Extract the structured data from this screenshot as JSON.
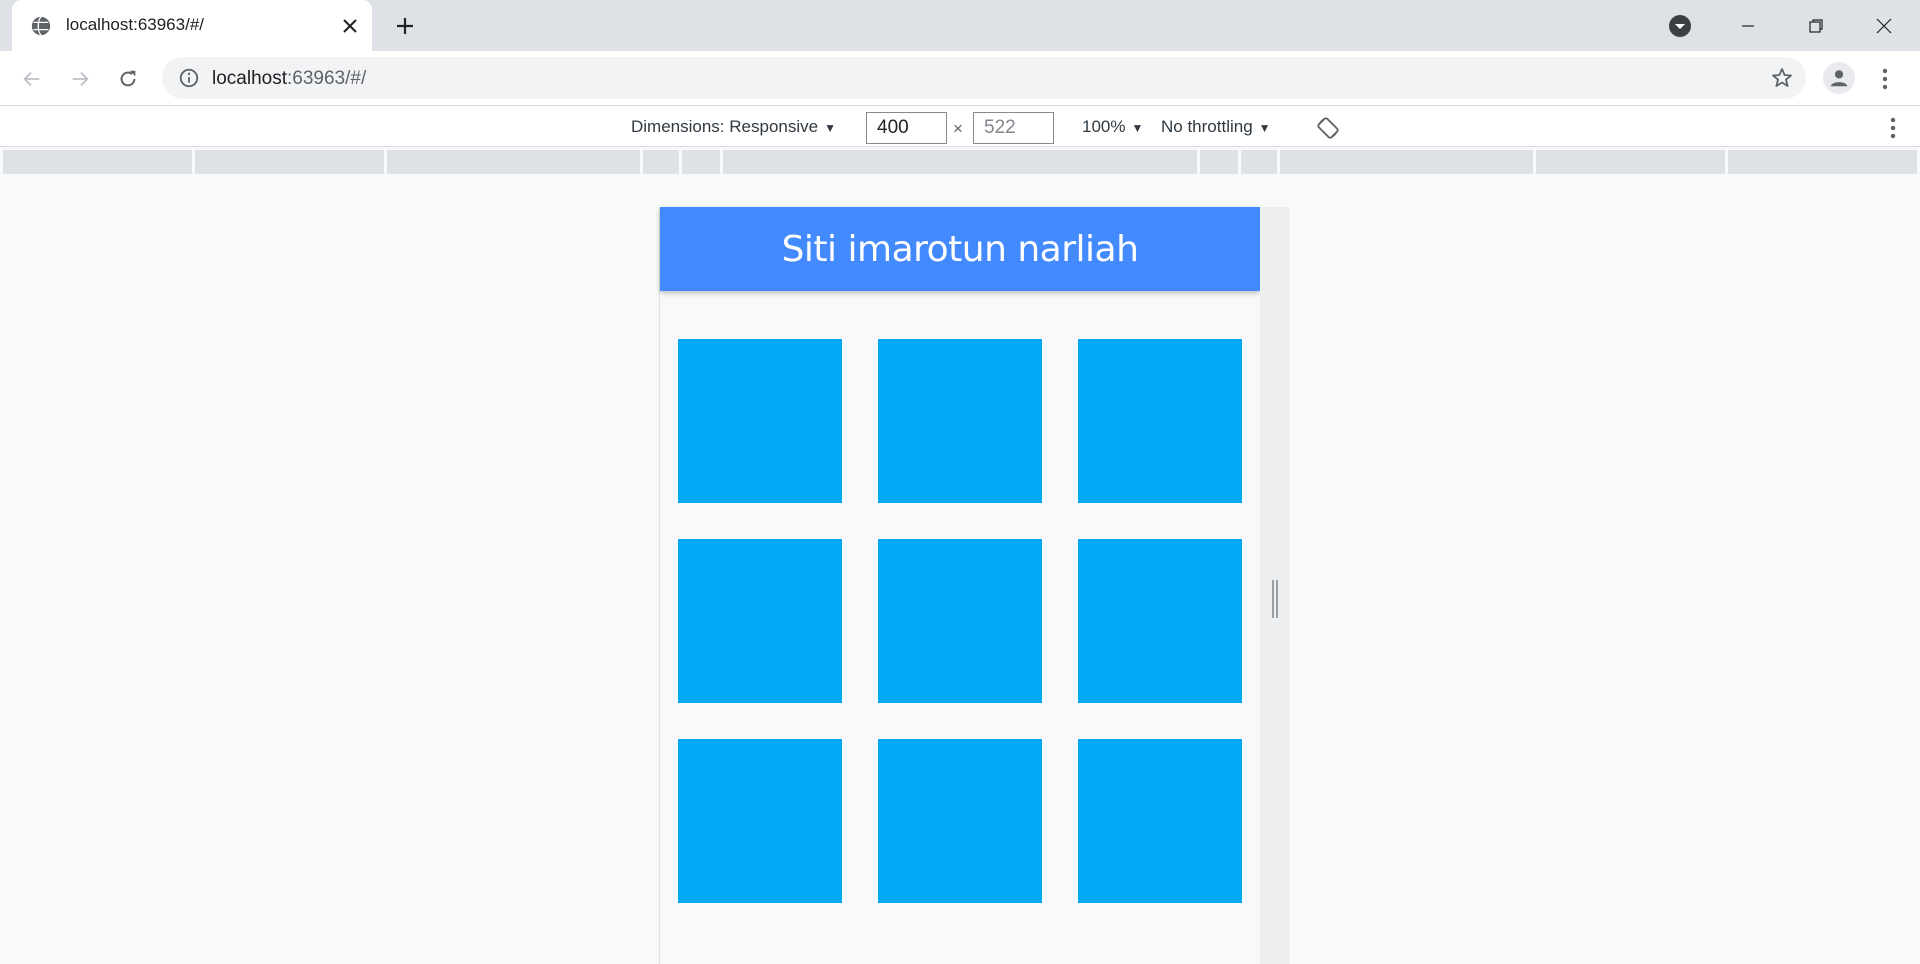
{
  "browser": {
    "tab_title": "localhost:63963/#/",
    "url_host": "localhost",
    "url_path": ":63963/#/"
  },
  "devtools": {
    "dimensions_label": "Dimensions: Responsive",
    "width_value": "400",
    "height_value": "522",
    "times": "×",
    "zoom_label": "100%",
    "throttle_label": "No throttling",
    "dropdown_arrow": "▼"
  },
  "app": {
    "title": "Siti imarotun narliah",
    "appbar_color": "#448aff",
    "box_color": "#03a9f4",
    "boxes": [
      "box-1",
      "box-2",
      "box-3",
      "box-4",
      "box-5",
      "box-6",
      "box-7",
      "box-8",
      "box-9"
    ]
  },
  "icons": {
    "tab_favicon": "globe-icon",
    "tab_close": "close-icon",
    "new_tab": "plus-icon",
    "back": "arrow-left-icon",
    "forward": "arrow-right-icon",
    "reload": "reload-icon",
    "site_info": "info-icon",
    "bookmark": "star-icon",
    "profile": "person-icon",
    "menu": "more-vertical-icon",
    "rotate": "rotate-icon",
    "tab_search": "tab-search-icon",
    "minimize": "minimize-icon",
    "restore": "restore-icon",
    "close_window": "close-window-icon"
  }
}
